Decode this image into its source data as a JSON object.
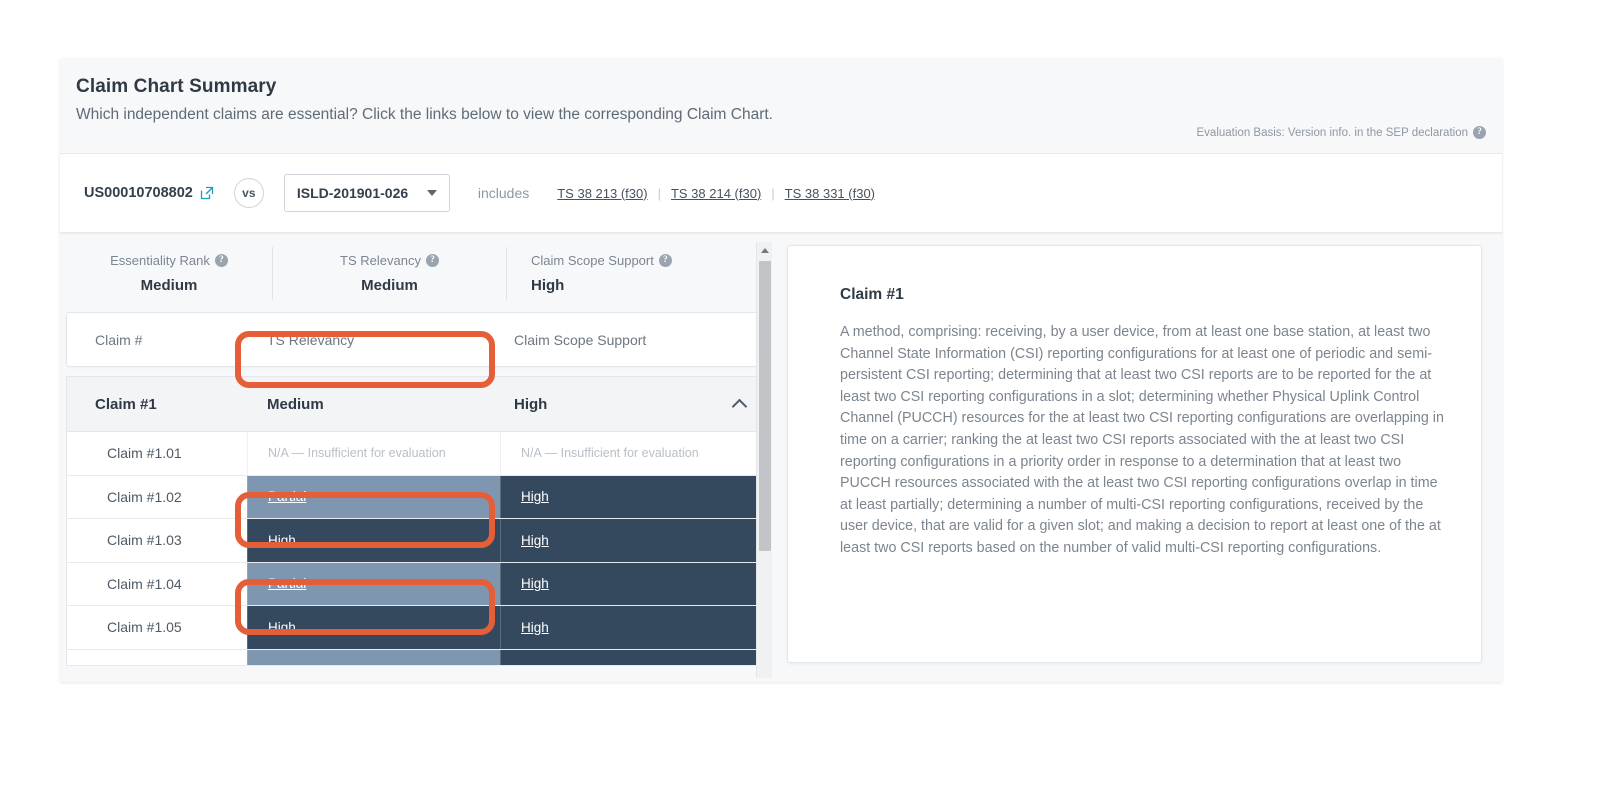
{
  "header": {
    "title": "Claim Chart Summary",
    "subtitle": "Which independent claims are essential? Click the links below to view the corresponding Claim Chart.",
    "evaluation_basis": "Evaluation Basis: Version info. in the SEP declaration",
    "help_glyph": "?"
  },
  "compare_bar": {
    "patent_id": "US00010708802",
    "external_link_icon": "external-link-icon",
    "vs_label": "vs",
    "standard_selected": "ISLD-201901-026",
    "includes_label": "includes",
    "ts_links": [
      "TS 38 213 (f30)",
      "TS 38 214 (f30)",
      "TS 38 331 (f30)"
    ],
    "separator": "|"
  },
  "rank_summary": [
    {
      "label": "Essentiality Rank",
      "value": "Medium"
    },
    {
      "label": "TS Relevancy",
      "value": "Medium"
    },
    {
      "label": "Claim Scope Support",
      "value": "High"
    }
  ],
  "table": {
    "columns": [
      "Claim #",
      "TS Relevancy",
      "Claim Scope Support"
    ],
    "group_row": {
      "claim": "Claim #1",
      "ts_relevancy": "Medium",
      "claim_scope_support": "High",
      "collapse_icon": "chevron-up-icon"
    },
    "rows": [
      {
        "claim": "Claim #1.01",
        "ts_relevancy": "N/A — Insufficient for evaluation",
        "ts_state": "na",
        "claim_scope_support": "N/A — Insufficient for evaluation",
        "css_state": "na"
      },
      {
        "claim": "Claim #1.02",
        "ts_relevancy": "Partial",
        "ts_state": "partial",
        "claim_scope_support": "High",
        "css_state": "high"
      },
      {
        "claim": "Claim #1.03",
        "ts_relevancy": "High",
        "ts_state": "high",
        "claim_scope_support": "High",
        "css_state": "high"
      },
      {
        "claim": "Claim #1.04",
        "ts_relevancy": "Partial",
        "ts_state": "partial",
        "claim_scope_support": "High",
        "css_state": "high"
      },
      {
        "claim": "Claim #1.05",
        "ts_relevancy": "High",
        "ts_state": "high",
        "claim_scope_support": "High",
        "css_state": "high"
      },
      {
        "claim": "",
        "ts_relevancy": "",
        "ts_state": "partial",
        "claim_scope_support": "",
        "css_state": "high"
      }
    ]
  },
  "claim_detail": {
    "title": "Claim #1",
    "body": "A method, comprising: receiving, by a user device, from at least one base station, at least two Channel State Information (CSI) reporting configurations for at least one of periodic and semi-persistent CSI reporting; determining that at least two CSI reports are to be reported for the at least two CSI reporting configurations in a slot; determining whether Physical Uplink Control Channel (PUCCH) resources for the at least two CSI reporting configurations are overlapping in time on a carrier; ranking the at least two CSI reports associated with the at least two CSI reporting configurations in a priority order in response to a determination that at least two PUCCH resources associated with the at least two CSI reporting configurations overlap in time at least partially; determining a number of multi-CSI reporting configurations, received by the user device, that are valid for a given slot; and making a decision to report at least one of the at least two CSI reports based on the number of valid multi-CSI reporting configurations."
  },
  "scrollbar": {
    "up_arrow_icon": "scroll-up-arrow-icon"
  },
  "highlights": [
    {
      "name": "ts-relevancy-column-header",
      "color": "#e55e37"
    },
    {
      "name": "ts-relevancy-partial-claim-1-02",
      "color": "#e55e37"
    },
    {
      "name": "ts-relevancy-partial-claim-1-04",
      "color": "#e55e37"
    }
  ],
  "colors": {
    "accent_orange": "#e55e37",
    "high_navy": "#34495e",
    "partial_blue": "#7e96b0",
    "link_teal": "#1a9fc4"
  }
}
